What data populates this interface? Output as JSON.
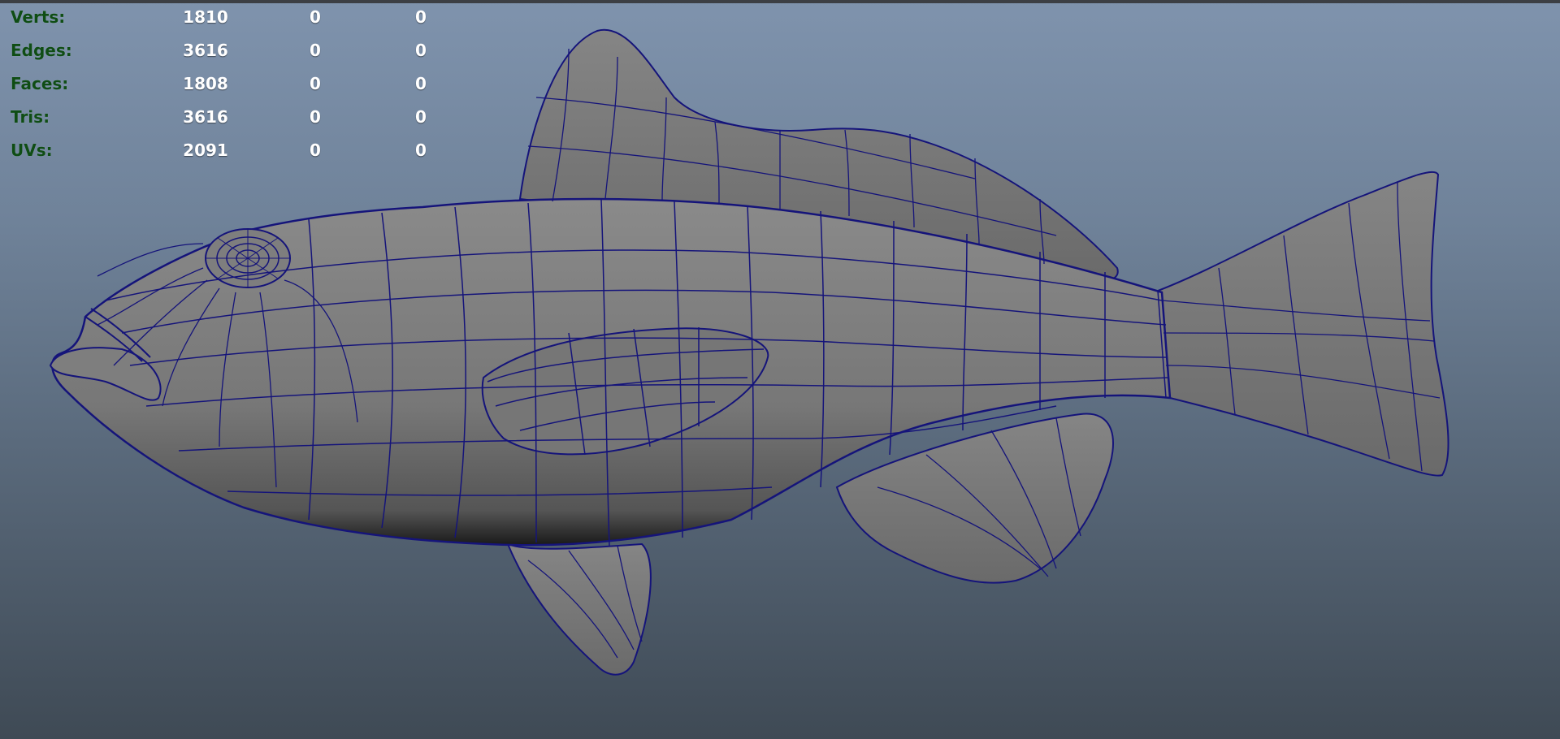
{
  "hud": {
    "rows": [
      {
        "label": "Verts:",
        "count": "1810",
        "selected": "0",
        "selected_2": "0"
      },
      {
        "label": "Edges:",
        "count": "3616",
        "selected": "0",
        "selected_2": "0"
      },
      {
        "label": "Faces:",
        "count": "1808",
        "selected": "0",
        "selected_2": "0"
      },
      {
        "label": "Tris:",
        "count": "3616",
        "selected": "0",
        "selected_2": "0"
      },
      {
        "label": "UVs:",
        "count": "2091",
        "selected": "0",
        "selected_2": "0"
      }
    ]
  },
  "colors": {
    "label_green": "#0f4d14",
    "wire_blue": "#15147a",
    "mesh_gray": "#7a7a7a",
    "bg_top": "#7f93ad",
    "bg_bottom": "#3f4a55"
  },
  "viewport": {
    "model_icon": "fish-wireframe-mesh"
  }
}
